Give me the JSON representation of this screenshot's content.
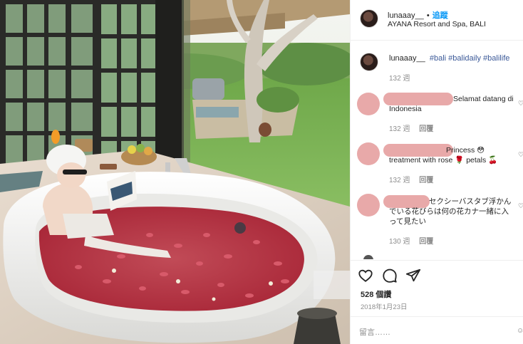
{
  "post": {
    "author": "lunaaay__",
    "separator": "•",
    "follow_label": "追蹤",
    "location": "AYANA Resort and Spa, BALI"
  },
  "caption": {
    "user": "lunaaay__",
    "tags": "#bali #balidaily #balilife",
    "time": "132 週"
  },
  "comments": [
    {
      "text": "Selamat datang di Indonesia",
      "time": "132 週",
      "reply_label": "回覆"
    },
    {
      "text": "Princess 😳 treatment with rose 🌹 petals 🍒",
      "time": "132 週",
      "reply_label": "回覆"
    },
    {
      "text": "セクシーバスタブ浮かんでいる花びらは何の花カナ一緒に入って見たい",
      "time": "130 週",
      "reply_label": "回覆"
    }
  ],
  "actions": {
    "likes": "528 個讚",
    "date": "2018年1月23日",
    "comment_placeholder": "留言……"
  },
  "icons": {
    "like": "heart-outline-icon",
    "comment": "speech-bubble-icon",
    "share": "paper-plane-icon",
    "emoji": "smiley-icon"
  },
  "colors": {
    "follow": "#0095f6",
    "hashtag": "#3b5998",
    "redaction": "#e8a9a9",
    "muted": "#8e8e8e"
  }
}
